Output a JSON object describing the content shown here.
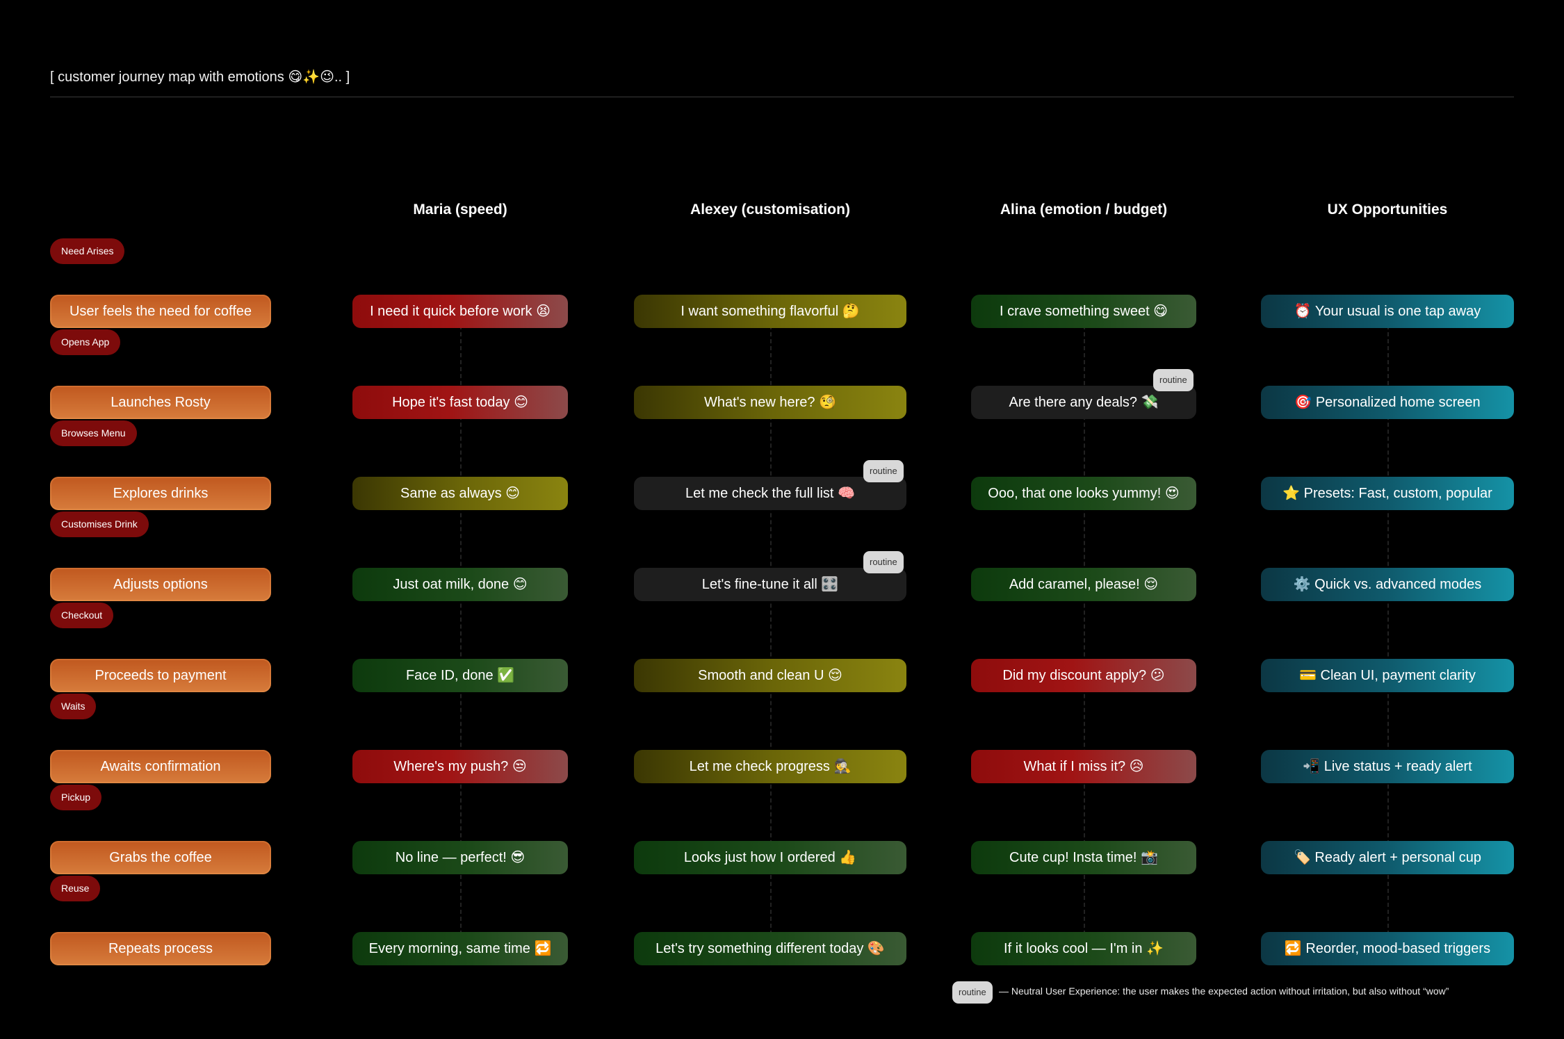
{
  "title": "[ customer journey map with emotions 😋✨😉.. ]",
  "columns": [
    "Maria (speed)",
    "Alexey (customisation)",
    "Alina (emotion / budget)",
    "UX Opportunities"
  ],
  "stages": [
    "Need Arises",
    "Opens App",
    "Browses Menu",
    "Customises Drink",
    "Checkout",
    "Waits",
    "Pickup",
    "Reuse"
  ],
  "actions": [
    "User feels the need for coffee",
    "Launches Rosty",
    "Explores drinks",
    "Adjusts options",
    "Proceeds to payment",
    "Awaits confirmation",
    "Grabs the coffee",
    "Repeats process"
  ],
  "maria": [
    {
      "text": "I need it quick before work 😫",
      "mood": "red"
    },
    {
      "text": "Hope it's fast today 😊",
      "mood": "red"
    },
    {
      "text": "Same as always 😊",
      "mood": "olive"
    },
    {
      "text": "Just oat milk, done 😊",
      "mood": "green"
    },
    {
      "text": "Face ID, done ✅",
      "mood": "green"
    },
    {
      "text": "Where's my push? 😒",
      "mood": "red"
    },
    {
      "text": "No line — perfect! 😎",
      "mood": "green"
    },
    {
      "text": "Every morning, same time 🔁",
      "mood": "green"
    }
  ],
  "alexey": [
    {
      "text": "I want something flavorful 🤔",
      "mood": "olive"
    },
    {
      "text": "What's new here? 🧐",
      "mood": "olive"
    },
    {
      "text": "Let me check the full list 🧠",
      "mood": "neutral",
      "badge": "routine"
    },
    {
      "text": "Let's fine-tune it all 🎛️",
      "mood": "neutral",
      "badge": "routine"
    },
    {
      "text": "Smooth and clean U 😌",
      "mood": "olive"
    },
    {
      "text": "Let me check progress 🕵️",
      "mood": "olive"
    },
    {
      "text": "Looks just how I ordered 👍",
      "mood": "green"
    },
    {
      "text": "Let's try something different today 🎨",
      "mood": "green"
    }
  ],
  "alina": [
    {
      "text": "I crave something sweet 😋",
      "mood": "green"
    },
    {
      "text": "Are there any deals? 💸",
      "mood": "neutral",
      "badge": "routine"
    },
    {
      "text": "Ooo, that one looks yummy! 😍",
      "mood": "green"
    },
    {
      "text": "Add caramel, please! 😌",
      "mood": "green"
    },
    {
      "text": "Did my discount apply? 😕",
      "mood": "red"
    },
    {
      "text": "What if I miss it? 😥",
      "mood": "red"
    },
    {
      "text": "Cute cup! Insta time! 📸",
      "mood": "green"
    },
    {
      "text": "If it looks cool — I'm in ✨",
      "mood": "green"
    }
  ],
  "opportunities": [
    "⏰ Your usual is one tap away",
    "🎯 Personalized home screen",
    "⭐ Presets: Fast, custom, popular",
    "⚙️ Quick vs. advanced modes",
    "💳 Clean UI, payment clarity",
    "📲 Live status + ready alert",
    "🏷️ Ready alert + personal cup",
    "🔁 Reorder, mood-based triggers"
  ],
  "legend": {
    "badge": "routine",
    "text": "— Neutral User Experience: the user makes the expected action without irritation, but also without “wow”"
  },
  "mood_colors": {
    "red": "#8e0c0c",
    "olive": "#6a6508",
    "green": "#1c4a19",
    "neutral": "#1e1e1e",
    "stage": "#7d0b0b",
    "action": "#c9652a",
    "opportunity": "#0f5a6c"
  }
}
